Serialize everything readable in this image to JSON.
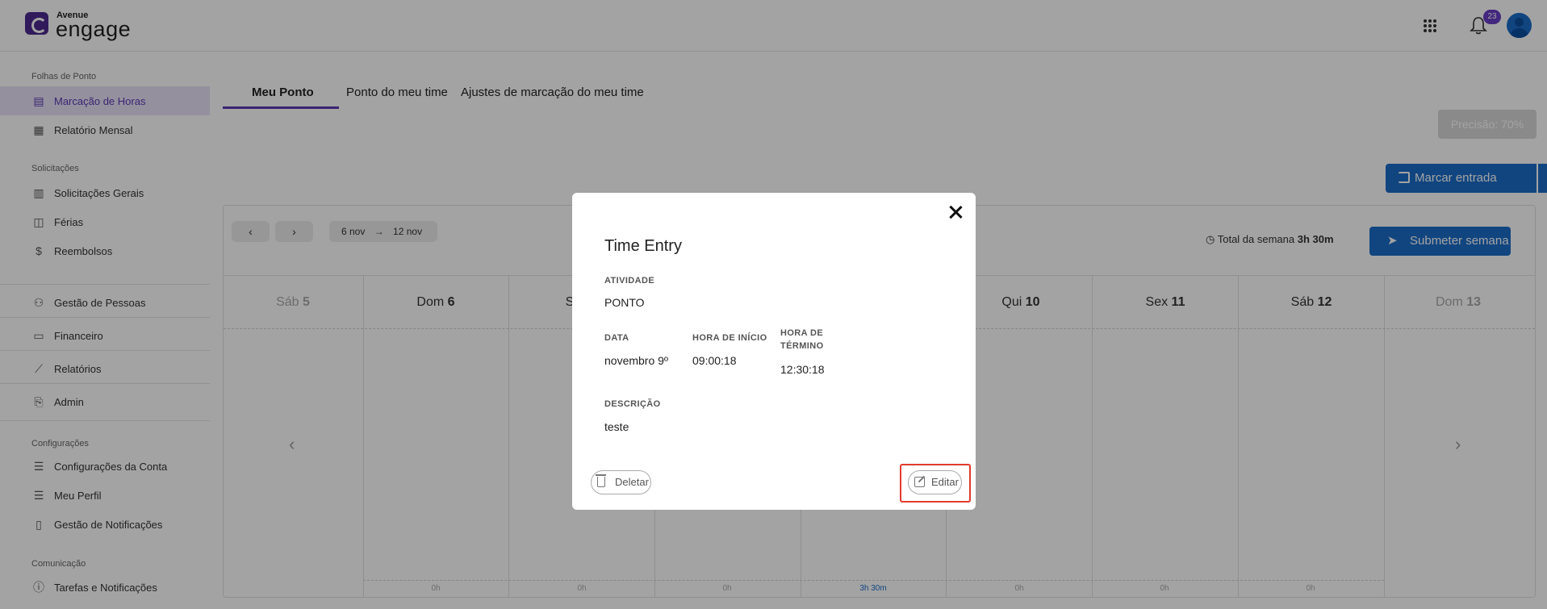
{
  "header": {
    "logo_top": "Avenue",
    "logo_main": "engage",
    "notification_count": "23"
  },
  "sidebar": {
    "sections": {
      "folhas": "Folhas de Ponto",
      "solicitacoes": "Solicitações",
      "configuracoes": "Configurações",
      "comunicacao": "Comunicação"
    },
    "items": [
      {
        "label": "Marcação de Horas",
        "icon": "timesheet-icon",
        "active": true
      },
      {
        "label": "Relatório Mensal",
        "icon": "calendar-icon"
      },
      {
        "label": "Solicitações Gerais",
        "icon": "form-icon"
      },
      {
        "label": "Férias",
        "icon": "suitcase-icon"
      },
      {
        "label": "Reembolsos",
        "icon": "dollar-icon"
      },
      {
        "label": "Gestão de Pessoas",
        "icon": "people-icon"
      },
      {
        "label": "Financeiro",
        "icon": "card-icon"
      },
      {
        "label": "Relatórios",
        "icon": "chart-icon"
      },
      {
        "label": "Admin",
        "icon": "admin-icon"
      },
      {
        "label": "Configurações da Conta",
        "icon": "list-icon"
      },
      {
        "label": "Meu Perfil",
        "icon": "list-icon"
      },
      {
        "label": "Gestão de Notificações",
        "icon": "file-icon"
      },
      {
        "label": "Tarefas e Notificações",
        "icon": "info-icon"
      }
    ]
  },
  "tabs": [
    {
      "label": "Meu Ponto",
      "active": true
    },
    {
      "label": "Ponto do meu time"
    },
    {
      "label": "Ajustes de marcação do meu time"
    }
  ],
  "actions": {
    "precision": "Precisão: 70%",
    "clock_in": "Marcar entrada",
    "submit_week": "Submeter semana"
  },
  "calendar": {
    "range_start": "6 nov",
    "range_end": "12 nov",
    "total_label": "Total da semana",
    "total_value": "3h 30m",
    "days": [
      {
        "name": "Sáb",
        "num": "5",
        "dim": true
      },
      {
        "name": "Dom",
        "num": "6"
      },
      {
        "name": "S",
        "num": ""
      },
      {
        "name": "Qui",
        "num": "10"
      },
      {
        "name": "Sex",
        "num": "11"
      },
      {
        "name": "Sáb",
        "num": "12"
      },
      {
        "name": "Dom",
        "num": "13",
        "dim": true
      }
    ],
    "hours": [
      "0h",
      "0h",
      "0h",
      "3h 30m",
      "0h",
      "0h",
      "0h"
    ]
  },
  "modal": {
    "title": "Time Entry",
    "activity_label": "ATIVIDADE",
    "activity_value": "PONTO",
    "date_label": "DATA",
    "date_value": "novembro 9º",
    "start_label": "HORA DE INÍCIO",
    "start_value": "09:00:18",
    "end_label_1": "HORA DE",
    "end_label_2": "TÉRMINO",
    "end_value": "12:30:18",
    "desc_label": "DESCRIÇÃO",
    "desc_value": "teste",
    "delete_label": "Deletar",
    "edit_label": "Editar"
  },
  "colors": {
    "brand": "#5b3bb5",
    "primary": "#1b6dc9",
    "highlight": "#e23b2d"
  }
}
